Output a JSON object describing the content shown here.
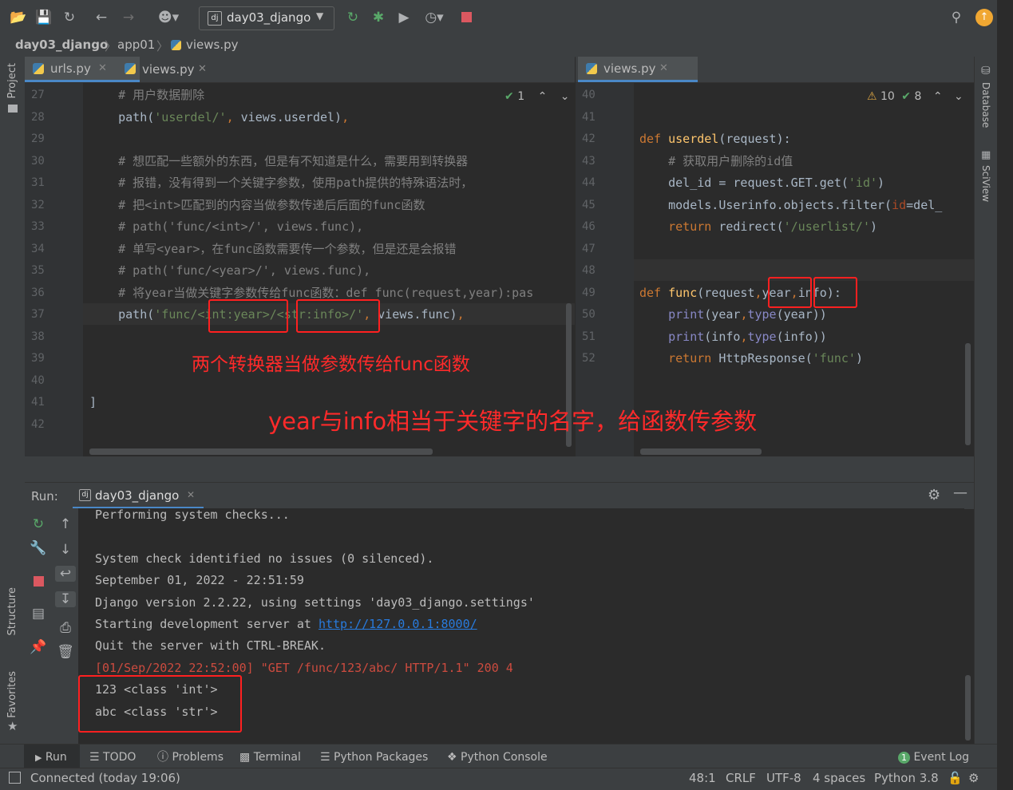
{
  "toolbar": {
    "run_config": "day03_django",
    "icons": [
      "open-folder-icon",
      "save-icon",
      "sync-icon",
      "back-icon",
      "forward-icon",
      "vcs-user-icon",
      "run-icon",
      "debug-icon",
      "coverage-icon",
      "profile-icon",
      "stop-icon",
      "search-icon",
      "update-icon"
    ],
    "colors": {
      "run": "#59a869",
      "stop": "#db5860",
      "update": "#f0a732"
    }
  },
  "breadcrumb": {
    "project": "day03_django",
    "folder": "app01",
    "file": "views.py"
  },
  "left_editor": {
    "tabs": [
      {
        "label": "urls.py",
        "active": true
      },
      {
        "label": "views.py",
        "active": false
      }
    ],
    "inspection": "1",
    "lines": [
      {
        "n": "27",
        "text": "    # 用户数据删除",
        "cls": "cm"
      },
      {
        "n": "28",
        "text": "    path('userdel/', views.userdel),",
        "cls": ""
      },
      {
        "n": "29",
        "text": "",
        "cls": ""
      },
      {
        "n": "30",
        "text": "    # 想匹配一些额外的东西，但是有不知道是什么，需要用到转换器",
        "cls": "cm"
      },
      {
        "n": "31",
        "text": "    # 报错，没有得到一个关键字参数，使用path提供的特殊语法时，",
        "cls": "cm"
      },
      {
        "n": "32",
        "text": "    # 把<int>匹配到的内容当做参数传递后后面的func函数",
        "cls": "cm"
      },
      {
        "n": "33",
        "text": "    # path('func/<int>/', views.func),",
        "cls": "cm"
      },
      {
        "n": "34",
        "text": "    # 单写<year>，在func函数需要传一个参数，但是还是会报错",
        "cls": "cm"
      },
      {
        "n": "35",
        "text": "    # path('func/<year>/', views.func),",
        "cls": "cm"
      },
      {
        "n": "36",
        "text": "    # 将year当做关键字参数传给func函数：def func(request,year):pas",
        "cls": "cm"
      },
      {
        "n": "37",
        "text": "    path('func/<int:year>/<str:info>/', views.func),",
        "cls": ""
      },
      {
        "n": "38",
        "text": "",
        "cls": ""
      },
      {
        "n": "39",
        "text": "",
        "cls": ""
      },
      {
        "n": "40",
        "text": "",
        "cls": ""
      },
      {
        "n": "41",
        "text": "]",
        "cls": ""
      },
      {
        "n": "42",
        "text": "",
        "cls": ""
      }
    ],
    "annotation": "两个转换器当做参数传给func函数"
  },
  "right_editor": {
    "tabs": [
      {
        "label": "views.py",
        "active": true
      }
    ],
    "warnings": "10",
    "checks": "8",
    "lines": [
      {
        "n": "40",
        "text": ""
      },
      {
        "n": "41",
        "text": ""
      },
      {
        "n": "42",
        "text": "def userdel(request):"
      },
      {
        "n": "43",
        "text": "    # 获取用户删除的id值"
      },
      {
        "n": "44",
        "text": "    del_id = request.GET.get('id')"
      },
      {
        "n": "45",
        "text": "    models.Userinfo.objects.filter(id=del_"
      },
      {
        "n": "46",
        "text": "    return redirect('/userlist/')"
      },
      {
        "n": "47",
        "text": ""
      },
      {
        "n": "48",
        "text": ""
      },
      {
        "n": "49",
        "text": "def func(request,year,info):"
      },
      {
        "n": "50",
        "text": "    print(year,type(year))"
      },
      {
        "n": "51",
        "text": "    print(info,type(info))"
      },
      {
        "n": "52",
        "text": "    return HttpResponse('func')"
      }
    ]
  },
  "annotation_main": "year与info相当于关键字的名字，给函数传参数",
  "side": {
    "project": "Project",
    "structure": "Structure",
    "favorites": "Favorites",
    "database": "Database",
    "sciview": "SciView"
  },
  "run_panel": {
    "label": "Run:",
    "tab": "day03_django",
    "output": [
      {
        "text": "Performing system checks...",
        "color": "#bbbbbb"
      },
      {
        "text": "",
        "color": "#bbbbbb"
      },
      {
        "text": "System check identified no issues (0 silenced).",
        "color": "#bbbbbb"
      },
      {
        "text": "September 01, 2022 - 22:51:59",
        "color": "#bbbbbb"
      },
      {
        "text": "Django version 2.2.22, using settings 'day03_django.settings'",
        "color": "#bbbbbb"
      },
      {
        "text": "Starting development server at ",
        "color": "#bbbbbb",
        "link": "http://127.0.0.1:8000/"
      },
      {
        "text": "Quit the server with CTRL-BREAK.",
        "color": "#bbbbbb"
      },
      {
        "text": "[01/Sep/2022 22:52:00] \"GET /func/123/abc/ HTTP/1.1\" 200 4",
        "color": "#cc4b3f"
      },
      {
        "text": "123 <class 'int'>",
        "color": "#bbbbbb"
      },
      {
        "text": "abc <class 'str'>",
        "color": "#bbbbbb"
      }
    ]
  },
  "bottom_tabs": [
    "Run",
    "TODO",
    "Problems",
    "Terminal",
    "Python Packages",
    "Python Console"
  ],
  "event_log": {
    "count": "1",
    "label": "Event Log"
  },
  "status": {
    "left": "Connected (today 19:06)",
    "position": "48:1",
    "line_sep": "CRLF",
    "encoding": "UTF-8",
    "indent": "4 spaces",
    "interpreter": "Python 3.8"
  }
}
